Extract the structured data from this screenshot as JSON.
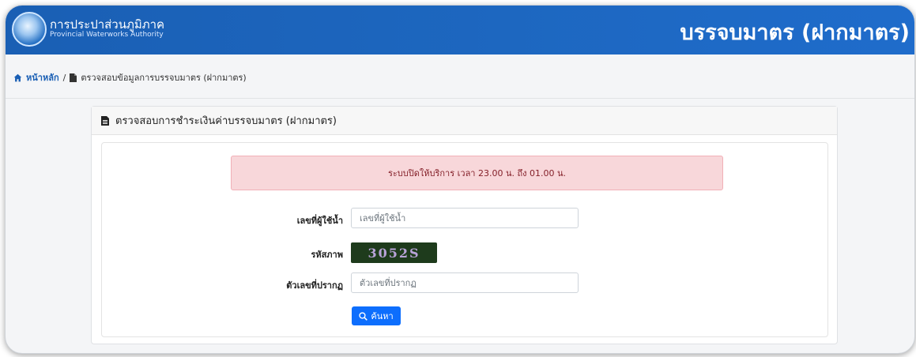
{
  "header": {
    "org_name_th": "การประปาส่วนภูมิภาค",
    "org_name_en": "Provincial Waterworks Authority",
    "page_title": "บรรจบมาตร (ฝากมาตร)"
  },
  "breadcrumb": {
    "home": "หน้าหลัก",
    "separator": "/",
    "current": "ตรวจสอบข้อมูลการบรรจบมาตร (ฝากมาตร)"
  },
  "card": {
    "title": "ตรวจสอบการชำระเงินค่าบรรจบมาตร (ฝากมาตร)"
  },
  "alert": {
    "message": "ระบบปิดให้บริการ เวลา 23.00 น. ถึง 01.00 น."
  },
  "form": {
    "customer_no_label": "เลขที่ผู้ใช้น้ำ",
    "customer_no_placeholder": "เลขที่ผู้ใช้น้ำ",
    "customer_no_value": "",
    "captcha_label": "รหัสภาพ",
    "captcha_text": "3052S",
    "captcha_input_label": "ตัวเลขที่ปรากฏ",
    "captcha_input_placeholder": "ตัวเลขที่ปรากฏ",
    "captcha_input_value": "",
    "search_button": "ค้นหา"
  },
  "colors": {
    "header_bg": "#1a5fb4",
    "alert_bg": "#f8d7da",
    "alert_text": "#842029",
    "button_bg": "#0d6efd"
  },
  "icons": {
    "home": "home-icon",
    "document": "document-icon",
    "search": "search-icon"
  }
}
